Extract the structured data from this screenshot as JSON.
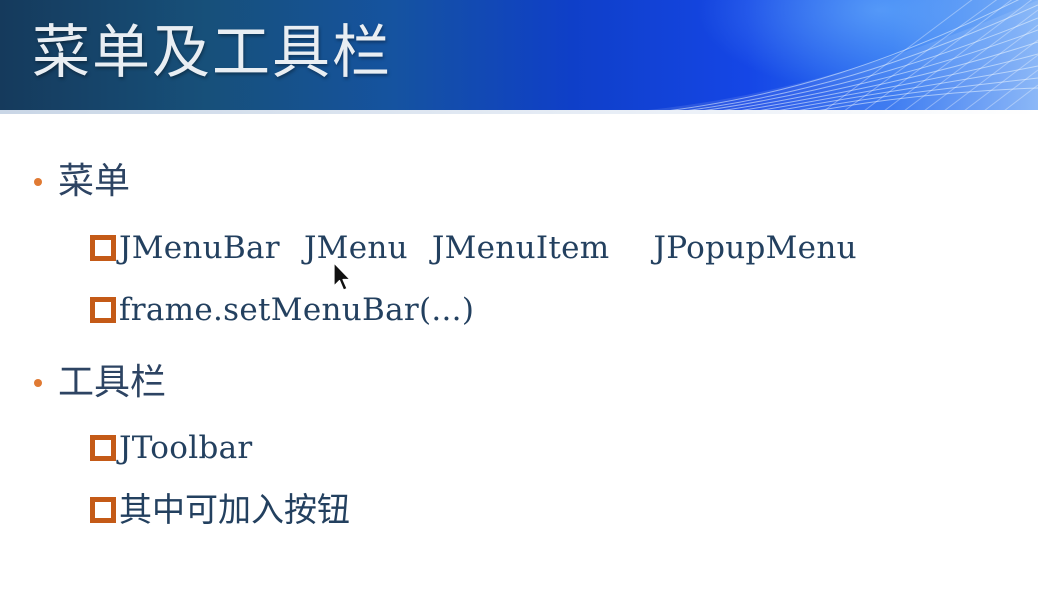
{
  "slide": {
    "title": "菜单及工具栏",
    "sections": [
      {
        "heading": "菜单",
        "items": [
          {
            "terms": [
              "JMenuBar",
              "JMenu",
              "JMenuItem",
              "JPopupMenu"
            ]
          },
          {
            "text": "frame.setMenuBar(...)"
          }
        ]
      },
      {
        "heading": "工具栏",
        "items": [
          {
            "text": "JToolbar"
          },
          {
            "text": "其中可加入按钮"
          }
        ]
      }
    ]
  },
  "colors": {
    "title_text": "#e9eef3",
    "banner_dark": "#153a5c",
    "banner_blue": "#1546e6",
    "bullet_dot": "#e07a33",
    "square_bullet": "#c45a17",
    "body_text": "#2d4463"
  },
  "icons": {
    "level1_bullet": "orange-dot-icon",
    "level2_bullet": "hollow-square-icon",
    "pointer": "mouse-cursor-icon"
  }
}
